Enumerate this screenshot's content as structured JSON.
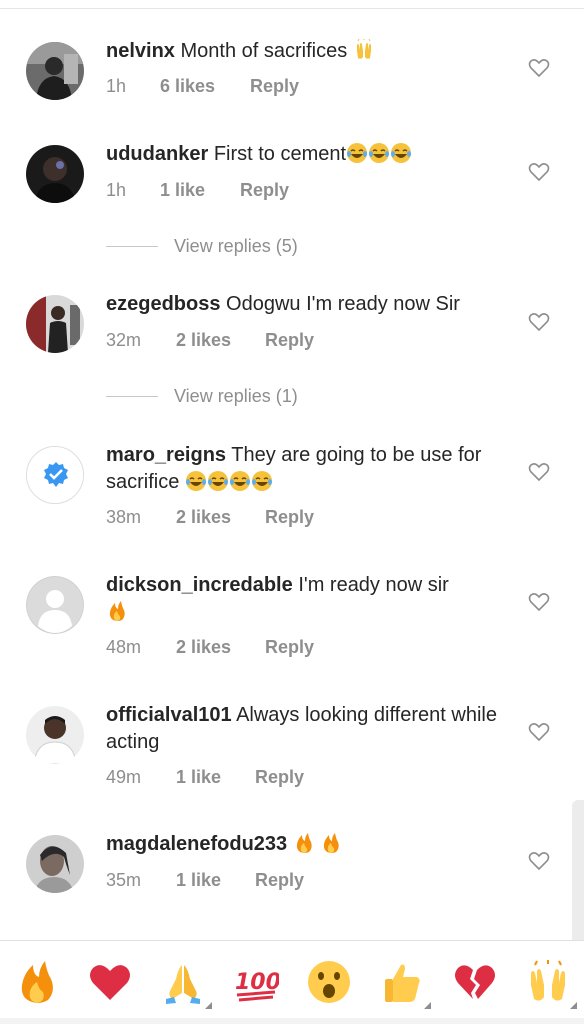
{
  "comments": [
    {
      "username": "nelvinx",
      "text": "Month of sacrifices",
      "emojis": [
        "raising-hands"
      ],
      "time": "1h",
      "likes": "6 likes",
      "reply": "Reply",
      "avatar": "photo-dark"
    },
    {
      "username": "ududanker",
      "text": "First to cement",
      "emojis": [
        "tears-of-joy",
        "tears-of-joy",
        "tears-of-joy"
      ],
      "time": "1h",
      "likes": "1 like",
      "reply": "Reply",
      "avatar": "photo-black"
    },
    {
      "username": "ezegedboss",
      "text": "Odogwu I'm ready now Sir",
      "emojis": [],
      "time": "32m",
      "likes": "2 likes",
      "reply": "Reply",
      "avatar": "photo-red"
    },
    {
      "username": "maro_reigns",
      "text": "They are going to be use for sacrifice",
      "emojis": [
        "tears-of-joy",
        "tears-of-joy",
        "tears-of-joy",
        "tears-of-joy"
      ],
      "time": "38m",
      "likes": "2 likes",
      "reply": "Reply",
      "avatar": "verified-badge"
    },
    {
      "username": "dickson_incredable",
      "text": "I'm ready now sir",
      "emojis": [
        "fire"
      ],
      "time": "48m",
      "likes": "2 likes",
      "reply": "Reply",
      "avatar": "default-silhouette"
    },
    {
      "username": "officialval101",
      "text": "Always looking different while acting",
      "emojis": [],
      "time": "49m",
      "likes": "1 like",
      "reply": "Reply",
      "avatar": "photo-light"
    },
    {
      "username": "magdalenefodu233",
      "text": "",
      "emojis": [
        "fire",
        "fire"
      ],
      "time": "35m",
      "likes": "1 like",
      "reply": "Reply",
      "avatar": "photo-grey"
    }
  ],
  "view_replies": [
    {
      "label": "View replies (5)"
    },
    {
      "label": "View replies (1)"
    }
  ],
  "emoji_bar": [
    "fire",
    "red-heart",
    "folded-hands",
    "hundred-points",
    "astonished-face",
    "thumbs-up",
    "broken-heart",
    "raising-hands"
  ],
  "colors": {
    "text": "#262626",
    "meta": "#8e8e8e",
    "verified": "#3897f0"
  }
}
